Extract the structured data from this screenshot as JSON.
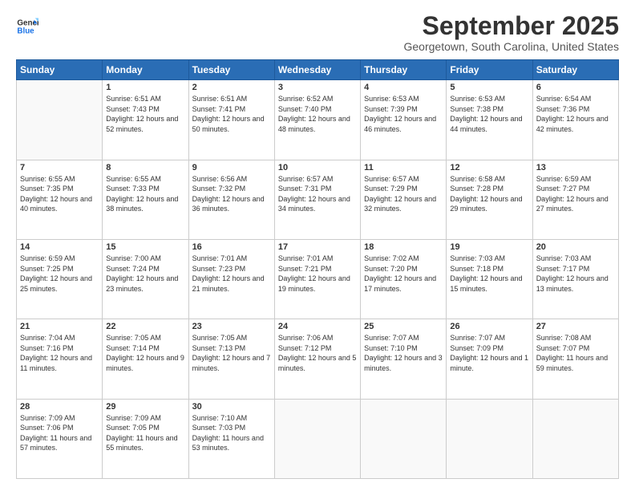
{
  "logo": {
    "text_general": "General",
    "text_blue": "Blue"
  },
  "header": {
    "month": "September 2025",
    "location": "Georgetown, South Carolina, United States"
  },
  "days_header": [
    "Sunday",
    "Monday",
    "Tuesday",
    "Wednesday",
    "Thursday",
    "Friday",
    "Saturday"
  ],
  "weeks": [
    [
      {
        "day": "",
        "empty": true
      },
      {
        "day": "1",
        "sunrise": "6:51 AM",
        "sunset": "7:43 PM",
        "daylight": "12 hours and 52 minutes."
      },
      {
        "day": "2",
        "sunrise": "6:51 AM",
        "sunset": "7:41 PM",
        "daylight": "12 hours and 50 minutes."
      },
      {
        "day": "3",
        "sunrise": "6:52 AM",
        "sunset": "7:40 PM",
        "daylight": "12 hours and 48 minutes."
      },
      {
        "day": "4",
        "sunrise": "6:53 AM",
        "sunset": "7:39 PM",
        "daylight": "12 hours and 46 minutes."
      },
      {
        "day": "5",
        "sunrise": "6:53 AM",
        "sunset": "7:38 PM",
        "daylight": "12 hours and 44 minutes."
      },
      {
        "day": "6",
        "sunrise": "6:54 AM",
        "sunset": "7:36 PM",
        "daylight": "12 hours and 42 minutes."
      }
    ],
    [
      {
        "day": "7",
        "sunrise": "6:55 AM",
        "sunset": "7:35 PM",
        "daylight": "12 hours and 40 minutes."
      },
      {
        "day": "8",
        "sunrise": "6:55 AM",
        "sunset": "7:33 PM",
        "daylight": "12 hours and 38 minutes."
      },
      {
        "day": "9",
        "sunrise": "6:56 AM",
        "sunset": "7:32 PM",
        "daylight": "12 hours and 36 minutes."
      },
      {
        "day": "10",
        "sunrise": "6:57 AM",
        "sunset": "7:31 PM",
        "daylight": "12 hours and 34 minutes."
      },
      {
        "day": "11",
        "sunrise": "6:57 AM",
        "sunset": "7:29 PM",
        "daylight": "12 hours and 32 minutes."
      },
      {
        "day": "12",
        "sunrise": "6:58 AM",
        "sunset": "7:28 PM",
        "daylight": "12 hours and 29 minutes."
      },
      {
        "day": "13",
        "sunrise": "6:59 AM",
        "sunset": "7:27 PM",
        "daylight": "12 hours and 27 minutes."
      }
    ],
    [
      {
        "day": "14",
        "sunrise": "6:59 AM",
        "sunset": "7:25 PM",
        "daylight": "12 hours and 25 minutes."
      },
      {
        "day": "15",
        "sunrise": "7:00 AM",
        "sunset": "7:24 PM",
        "daylight": "12 hours and 23 minutes."
      },
      {
        "day": "16",
        "sunrise": "7:01 AM",
        "sunset": "7:23 PM",
        "daylight": "12 hours and 21 minutes."
      },
      {
        "day": "17",
        "sunrise": "7:01 AM",
        "sunset": "7:21 PM",
        "daylight": "12 hours and 19 minutes."
      },
      {
        "day": "18",
        "sunrise": "7:02 AM",
        "sunset": "7:20 PM",
        "daylight": "12 hours and 17 minutes."
      },
      {
        "day": "19",
        "sunrise": "7:03 AM",
        "sunset": "7:18 PM",
        "daylight": "12 hours and 15 minutes."
      },
      {
        "day": "20",
        "sunrise": "7:03 AM",
        "sunset": "7:17 PM",
        "daylight": "12 hours and 13 minutes."
      }
    ],
    [
      {
        "day": "21",
        "sunrise": "7:04 AM",
        "sunset": "7:16 PM",
        "daylight": "12 hours and 11 minutes."
      },
      {
        "day": "22",
        "sunrise": "7:05 AM",
        "sunset": "7:14 PM",
        "daylight": "12 hours and 9 minutes."
      },
      {
        "day": "23",
        "sunrise": "7:05 AM",
        "sunset": "7:13 PM",
        "daylight": "12 hours and 7 minutes."
      },
      {
        "day": "24",
        "sunrise": "7:06 AM",
        "sunset": "7:12 PM",
        "daylight": "12 hours and 5 minutes."
      },
      {
        "day": "25",
        "sunrise": "7:07 AM",
        "sunset": "7:10 PM",
        "daylight": "12 hours and 3 minutes."
      },
      {
        "day": "26",
        "sunrise": "7:07 AM",
        "sunset": "7:09 PM",
        "daylight": "12 hours and 1 minute."
      },
      {
        "day": "27",
        "sunrise": "7:08 AM",
        "sunset": "7:07 PM",
        "daylight": "11 hours and 59 minutes."
      }
    ],
    [
      {
        "day": "28",
        "sunrise": "7:09 AM",
        "sunset": "7:06 PM",
        "daylight": "11 hours and 57 minutes."
      },
      {
        "day": "29",
        "sunrise": "7:09 AM",
        "sunset": "7:05 PM",
        "daylight": "11 hours and 55 minutes."
      },
      {
        "day": "30",
        "sunrise": "7:10 AM",
        "sunset": "7:03 PM",
        "daylight": "11 hours and 53 minutes."
      },
      {
        "day": "",
        "empty": true
      },
      {
        "day": "",
        "empty": true
      },
      {
        "day": "",
        "empty": true
      },
      {
        "day": "",
        "empty": true
      }
    ]
  ]
}
